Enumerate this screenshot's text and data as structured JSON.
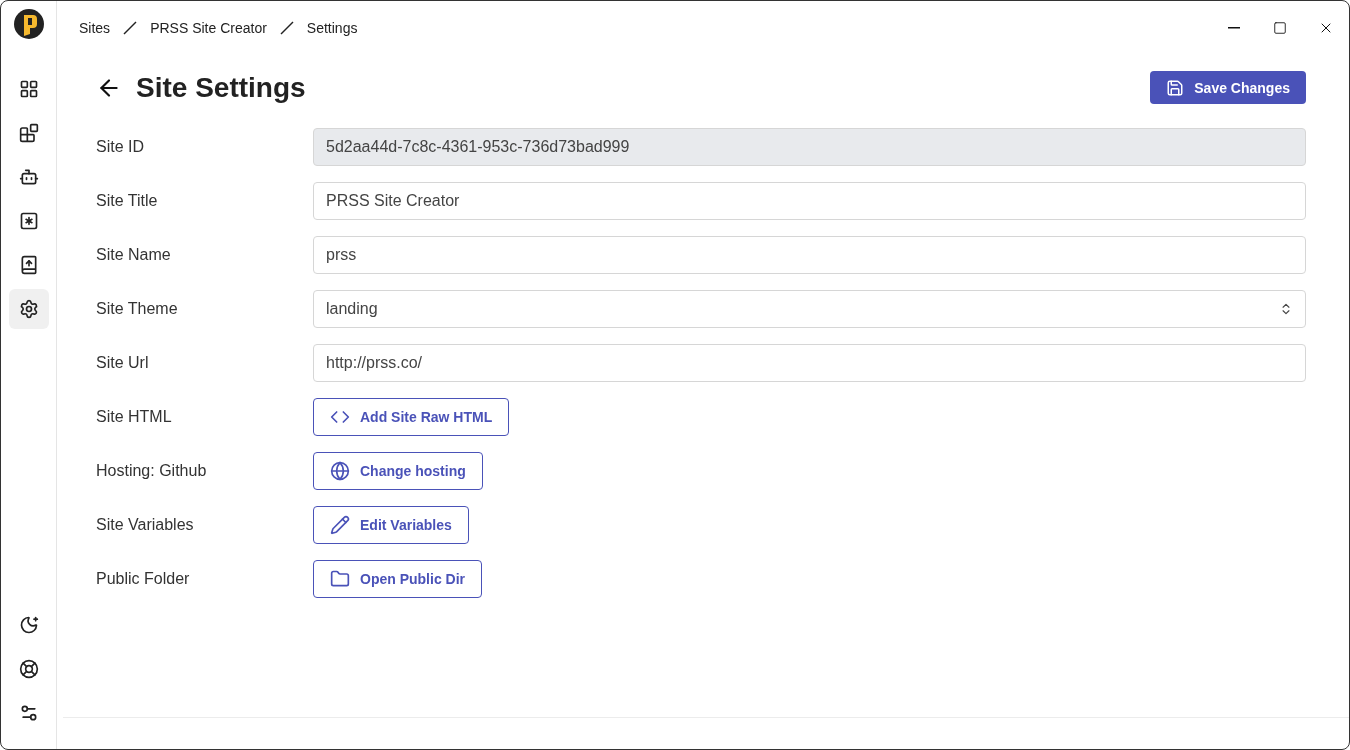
{
  "sidebar": {
    "items": [
      {
        "selected": false
      },
      {
        "selected": false
      },
      {
        "selected": false
      },
      {
        "selected": false
      },
      {
        "selected": false
      },
      {
        "selected": true
      }
    ]
  },
  "breadcrumbs": [
    "Sites",
    "PRSS Site Creator",
    "Settings"
  ],
  "page": {
    "title": "Site Settings",
    "save_button": "Save Changes"
  },
  "fields": [
    {
      "label": "Site ID",
      "kind": "readonly",
      "value": "5d2aa44d-7c8c-4361-953c-736d73bad999"
    },
    {
      "label": "Site Title",
      "kind": "text",
      "value": "PRSS Site Creator"
    },
    {
      "label": "Site Name",
      "kind": "text",
      "value": "prss"
    },
    {
      "label": "Site Theme",
      "kind": "select",
      "value": "landing"
    },
    {
      "label": "Site Url",
      "kind": "text",
      "value": "http://prss.co/"
    },
    {
      "label": "Site HTML",
      "kind": "button",
      "value": "Add Site Raw HTML"
    },
    {
      "label": "Hosting: Github",
      "kind": "button",
      "value": "Change hosting"
    },
    {
      "label": "Site Variables",
      "kind": "button",
      "value": "Edit Variables"
    },
    {
      "label": "Public Folder",
      "kind": "button",
      "value": "Open Public Dir"
    }
  ]
}
